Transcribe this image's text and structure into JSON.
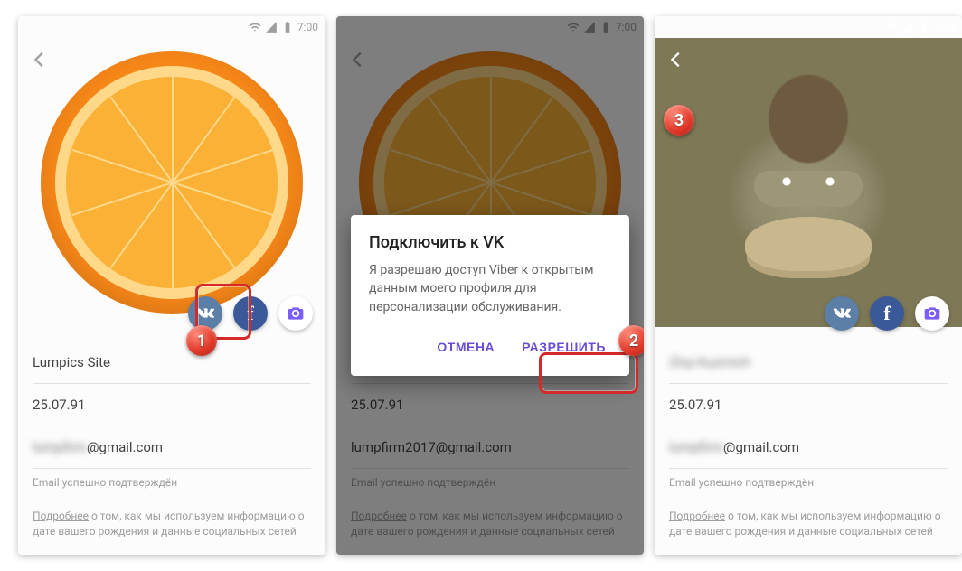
{
  "status": {
    "time": "7:00"
  },
  "profile": {
    "name": "Lumpics Site",
    "name3_blur": "Zloy Kuzmich",
    "birthdate": "25.07.91",
    "email_blur": "lumpfirm",
    "email_suffix": "@gmail.com",
    "email2": "lumpfirm2017@gmail.com",
    "email_confirmed": "Email успешно подтверждён",
    "more_link": "Подробнее",
    "more_text": " о том, как мы используем информацию о дате вашего рождения и данные социальных сетей"
  },
  "dialog": {
    "title": "Подключить к VK",
    "body": "Я разрешаю доступ Viber к открытым данным моего профиля для персонализации обслуживания.",
    "cancel": "ОТМЕНА",
    "allow": "РАЗРЕШИТЬ"
  },
  "steps": {
    "one": "1",
    "two": "2",
    "three": "3"
  },
  "icons": {
    "vk": "w",
    "fb": "f"
  }
}
